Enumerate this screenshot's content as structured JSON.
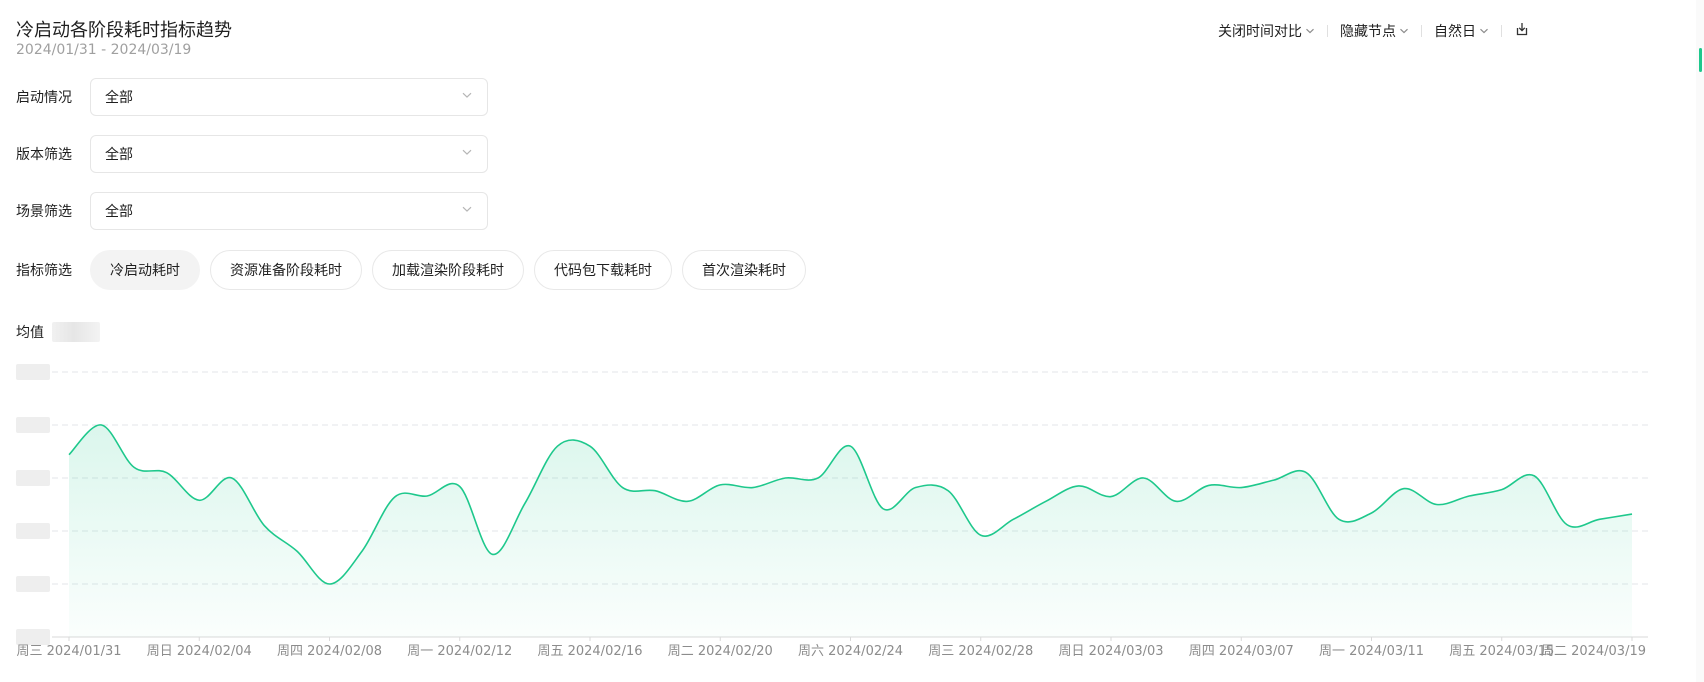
{
  "header": {
    "title": "冷启动各阶段耗时指标趋势",
    "date_range": "2024/01/31 - 2024/03/19"
  },
  "toolbar": {
    "compare_label": "关闭时间对比",
    "hide_nodes_label": "隐藏节点",
    "granularity_label": "自然日",
    "export_icon": "export-icon"
  },
  "filters": {
    "launch": {
      "label": "启动情况",
      "value": "全部"
    },
    "version": {
      "label": "版本筛选",
      "value": "全部"
    },
    "scene": {
      "label": "场景筛选",
      "value": "全部"
    }
  },
  "metrics": {
    "label": "指标筛选",
    "options": [
      "冷启动耗时",
      "资源准备阶段耗时",
      "加载渲染阶段耗时",
      "代码包下载耗时",
      "首次渲染耗时"
    ],
    "active_index": 0
  },
  "average": {
    "label": "均值"
  },
  "colors": {
    "accent": "#1ec88c",
    "grid": "#e3e6ea",
    "axis_text": "#8c8c8c"
  },
  "chart_data": {
    "type": "area",
    "title": "",
    "xlabel": "",
    "ylabel": "",
    "y_ticks_obscured": true,
    "ylim": [
      0,
      5
    ],
    "grid": true,
    "smooth": true,
    "x_tick_labels": [
      "周三 2024/01/31",
      "周日 2024/02/04",
      "周四 2024/02/08",
      "周一 2024/02/12",
      "周五 2024/02/16",
      "周二 2024/02/20",
      "周六 2024/02/24",
      "周三 2024/02/28",
      "周日 2024/03/03",
      "周四 2024/03/07",
      "周一 2024/03/11",
      "周五 2024/03/15",
      "周二 2024/03/19"
    ],
    "x": [
      "2024/01/31",
      "2024/02/01",
      "2024/02/02",
      "2024/02/03",
      "2024/02/04",
      "2024/02/05",
      "2024/02/06",
      "2024/02/07",
      "2024/02/08",
      "2024/02/09",
      "2024/02/10",
      "2024/02/11",
      "2024/02/12",
      "2024/02/13",
      "2024/02/14",
      "2024/02/15",
      "2024/02/16",
      "2024/02/17",
      "2024/02/18",
      "2024/02/19",
      "2024/02/20",
      "2024/02/21",
      "2024/02/22",
      "2024/02/23",
      "2024/02/24",
      "2024/02/25",
      "2024/02/26",
      "2024/02/27",
      "2024/02/28",
      "2024/02/29",
      "2024/03/01",
      "2024/03/02",
      "2024/03/03",
      "2024/03/04",
      "2024/03/05",
      "2024/03/06",
      "2024/03/07",
      "2024/03/08",
      "2024/03/09",
      "2024/03/10",
      "2024/03/11",
      "2024/03/12",
      "2024/03/13",
      "2024/03/14",
      "2024/03/15",
      "2024/03/16",
      "2024/03/17",
      "2024/03/18",
      "2024/03/19"
    ],
    "values": [
      3.44,
      4.0,
      3.2,
      3.1,
      2.58,
      3.0,
      2.1,
      1.62,
      1.0,
      1.62,
      2.64,
      2.66,
      2.84,
      1.56,
      2.52,
      3.6,
      3.6,
      2.82,
      2.76,
      2.56,
      2.87,
      2.82,
      3.0,
      3.0,
      3.6,
      2.42,
      2.82,
      2.76,
      1.92,
      2.22,
      2.56,
      2.85,
      2.65,
      3.0,
      2.56,
      2.86,
      2.82,
      2.96,
      3.1,
      2.22,
      2.34,
      2.8,
      2.5,
      2.66,
      2.78,
      3.04,
      2.12,
      2.22,
      2.32
    ]
  }
}
